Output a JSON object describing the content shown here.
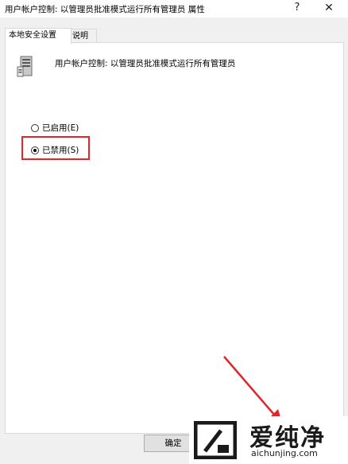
{
  "window": {
    "title": "用户帐户控制: 以管理员批准模式运行所有管理员 属性",
    "help_glyph": "?",
    "close_glyph": "✕"
  },
  "tabs": [
    {
      "label": "本地安全设置",
      "active": true
    },
    {
      "label": "说明",
      "active": false
    }
  ],
  "policy": {
    "icon": "server-policy-icon",
    "label": "用户帐户控制: 以管理员批准模式运行所有管理员"
  },
  "options": [
    {
      "label": "已启用(E)",
      "checked": false
    },
    {
      "label": "已禁用(S)",
      "checked": true
    }
  ],
  "buttons": {
    "ok_label": "确定"
  },
  "annotation": {
    "highlight_color": "#e0262c"
  },
  "watermark": {
    "brand_cn": "爱纯净",
    "url": "aichunjing.com"
  }
}
